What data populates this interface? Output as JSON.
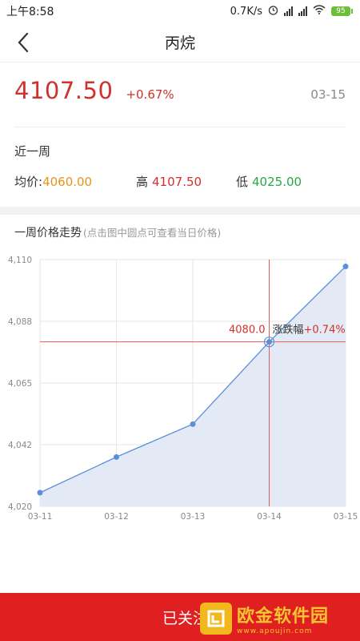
{
  "status_bar": {
    "time": "上午8:58",
    "net_speed": "0.7K/s",
    "battery": "95"
  },
  "header": {
    "title": "丙烷"
  },
  "quote": {
    "price": "4107.50",
    "change_pct": "+0.67%",
    "date": "03-15"
  },
  "summary": {
    "period_label": "近一周",
    "avg_label": "均价:",
    "avg_value": "4060.00",
    "high_label": "高",
    "high_value": "4107.50",
    "low_label": "低",
    "low_value": "4025.00"
  },
  "trend": {
    "title": "一周价格走势",
    "hint": "(点击图中圆点可查看当日价格)"
  },
  "chart_data": {
    "type": "area",
    "x": [
      "03-11",
      "03-12",
      "03-13",
      "03-14",
      "03-15"
    ],
    "values": [
      4025.0,
      4038.0,
      4050.0,
      4080.0,
      4107.5
    ],
    "y_ticks": [
      "4,110",
      "4,088",
      "4,065",
      "4,042",
      "4,020"
    ],
    "ylim": [
      4020,
      4110
    ],
    "grid": true,
    "selected_index": 3,
    "tooltip_value": "4080.0",
    "tooltip_label": "涨跌幅",
    "tooltip_change": "+0.74%",
    "colors": {
      "line": "#5b8fd9",
      "fill": "#e3eaf5",
      "crosshair": "#e35a5a",
      "grid": "#e6e6e6"
    }
  },
  "footer": {
    "follow_label": "已关注"
  },
  "watermark": {
    "brand": "欧金软件园",
    "url": "www.apoujin.com"
  },
  "colors": {
    "accent_red": "#d0312d",
    "orange": "#e89317",
    "green": "#27a844",
    "footer_bg": "#e02020"
  }
}
